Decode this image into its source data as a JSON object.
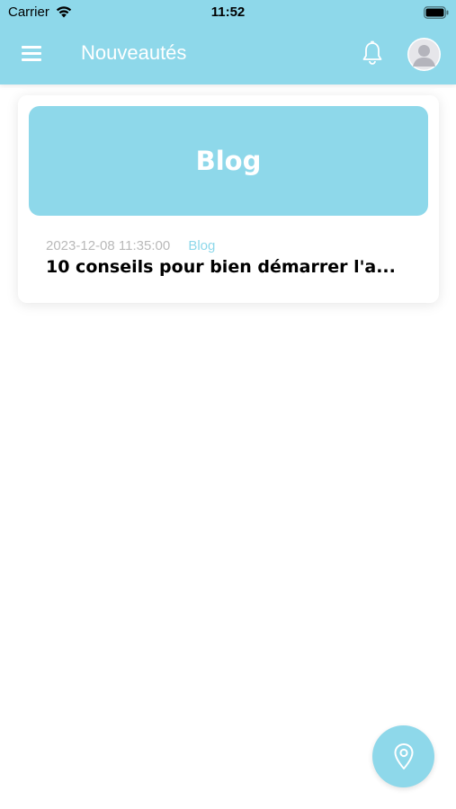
{
  "status_bar": {
    "carrier": "Carrier",
    "time": "11:52"
  },
  "header": {
    "title": "Nouveautés",
    "menu_icon": "hamburger-menu-icon",
    "notification_icon": "bell-icon",
    "avatar_icon": "user-avatar-icon"
  },
  "feed": {
    "items": [
      {
        "banner_label": "Blog",
        "date": "2023-12-08 11:35:00",
        "category": "Blog",
        "title": "10 conseils pour bien démarrer l'a..."
      }
    ]
  },
  "fab": {
    "icon": "map-pin-icon"
  },
  "colors": {
    "accent": "#8ed8ea",
    "date_text": "#b9b9b9",
    "background": "#ffffff"
  }
}
